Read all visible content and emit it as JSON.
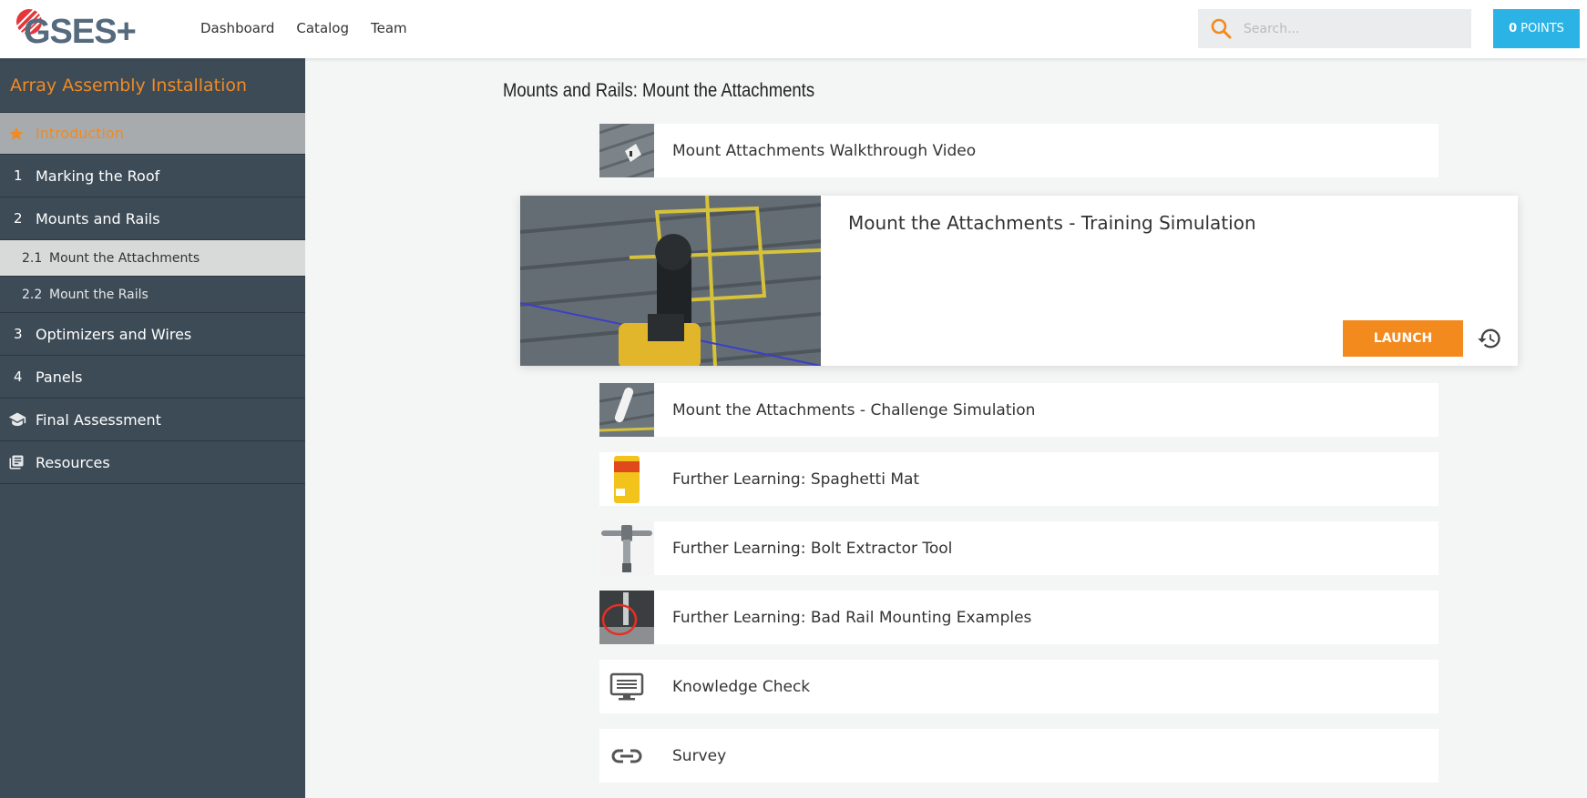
{
  "header": {
    "logo_text": "GSES+",
    "nav": [
      "Dashboard",
      "Catalog",
      "Team"
    ],
    "search_placeholder": "Search...",
    "points_value": "0",
    "points_label": "POINTS"
  },
  "sidebar": {
    "course_title": "Array Assembly Installation",
    "intro_label": "Introduction",
    "items": [
      {
        "num": "1",
        "label": "Marking the Roof"
      },
      {
        "num": "2",
        "label": "Mounts and Rails"
      },
      {
        "num": "2.1",
        "label": "Mount the Attachments"
      },
      {
        "num": "2.2",
        "label": "Mount the Rails"
      },
      {
        "num": "3",
        "label": "Optimizers and Wires"
      },
      {
        "num": "4",
        "label": "Panels"
      },
      {
        "label": "Final Assessment"
      },
      {
        "label": "Resources"
      }
    ]
  },
  "main": {
    "section_title": "Mounts and Rails: Mount the Attachments",
    "featured": {
      "title": "Mount the Attachments - Training Simulation",
      "launch_label": "LAUNCH"
    },
    "items": [
      {
        "label": "Mount Attachments Walkthrough Video"
      },
      {
        "label": "Mount the Attachments - Challenge Simulation"
      },
      {
        "label": "Further Learning: Spaghetti Mat"
      },
      {
        "label": "Further Learning: Bolt Extractor Tool"
      },
      {
        "label": "Further Learning: Bad Rail Mounting Examples"
      },
      {
        "label": "Knowledge Check"
      },
      {
        "label": "Survey"
      }
    ]
  },
  "colors": {
    "accent_orange": "#f08a24",
    "points_blue": "#2bb3e6",
    "sidebar_bg": "#3d4b56"
  }
}
